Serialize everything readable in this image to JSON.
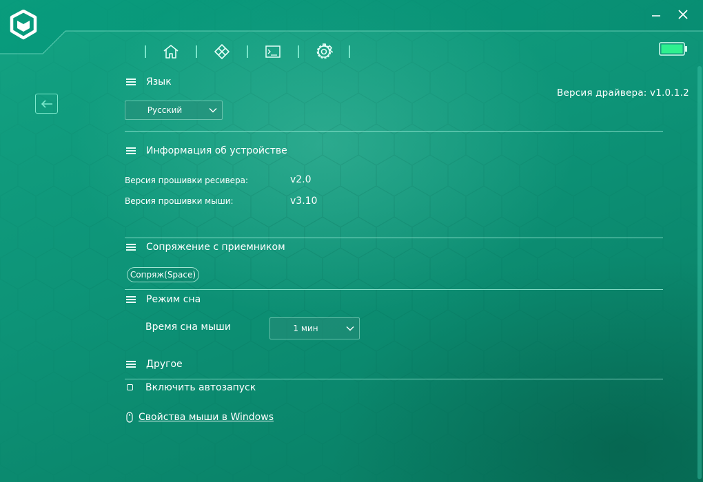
{
  "window": {
    "minimize_label": "—",
    "close_label": "✕"
  },
  "icons": {
    "logo": "cube-logo-icon",
    "minimize": "minimize-icon",
    "close": "close-icon",
    "battery": "battery-icon",
    "nav": [
      "home-icon",
      "diamond-grid-icon",
      "terminal-icon",
      "gear-icon"
    ],
    "back": "arrow-left-icon",
    "section": "hamburger-icon",
    "dropdown": "chevron-down-icon",
    "mouse": "mouse-icon"
  },
  "colors": {
    "accent": "#7ee9cd",
    "battery_fill": "#2ef08f",
    "background": "#0d9377"
  },
  "battery": {
    "level": 1.0
  },
  "driver_version": "Версия драйвера: v1.0.1.2",
  "language": {
    "title": "Язык",
    "selected": "Русский"
  },
  "device_info": {
    "title": "Информация об устройстве",
    "rows": [
      {
        "label": "Версия прошивки ресивера:",
        "value": "v2.0"
      },
      {
        "label": "Версия прошивки мыши:",
        "value": "v3.10"
      }
    ]
  },
  "pairing": {
    "title": "Сопряжение с приемником",
    "button": "Сопряж(Space)"
  },
  "sleep": {
    "title": "Режим сна",
    "label": "Время сна мыши",
    "selected": "1 мин"
  },
  "other": {
    "title": "Другое",
    "autostart_label": "Включить автозапуск",
    "autostart_checked": false,
    "link": "Свойства мыши в Windows"
  }
}
